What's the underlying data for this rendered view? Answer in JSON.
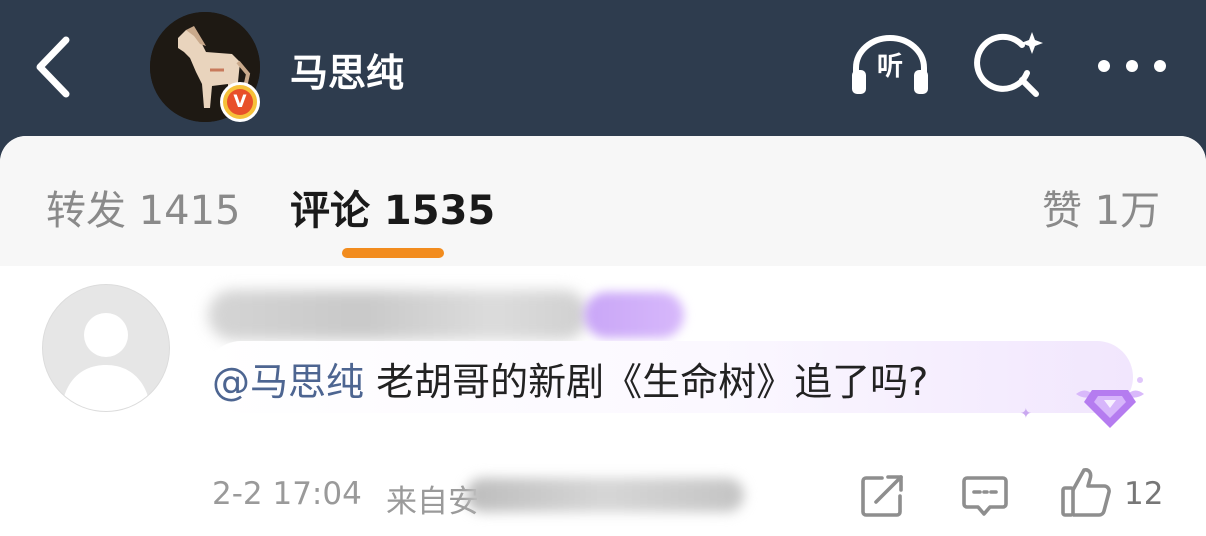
{
  "header": {
    "username": "马思纯",
    "listen_label": "听",
    "verified_mark": "V",
    "icons": {
      "back": "back-chevron-icon",
      "listen": "headphones-icon",
      "search": "ai-search-icon",
      "more": "more-dots-icon"
    }
  },
  "tabs": {
    "forward_label": "转发 1415",
    "comments_label": "评论 1535",
    "likes_label": "赞 1万",
    "active": "comments",
    "indicator_color": "#f28c1e"
  },
  "comment": {
    "mention": "@马思纯",
    "text": " 老胡哥的新剧《生命树》追了吗?",
    "time": "2-2 17:04",
    "source_label": "来自安",
    "like_count": "12",
    "icons": {
      "share": "share-icon",
      "reply": "comment-icon",
      "like": "thumbs-up-icon",
      "badge": "vip-diamond-badge-icon"
    }
  },
  "colors": {
    "header_bg": "#2e3c4e",
    "mention": "#4d6591",
    "accent": "#f28c1e"
  }
}
